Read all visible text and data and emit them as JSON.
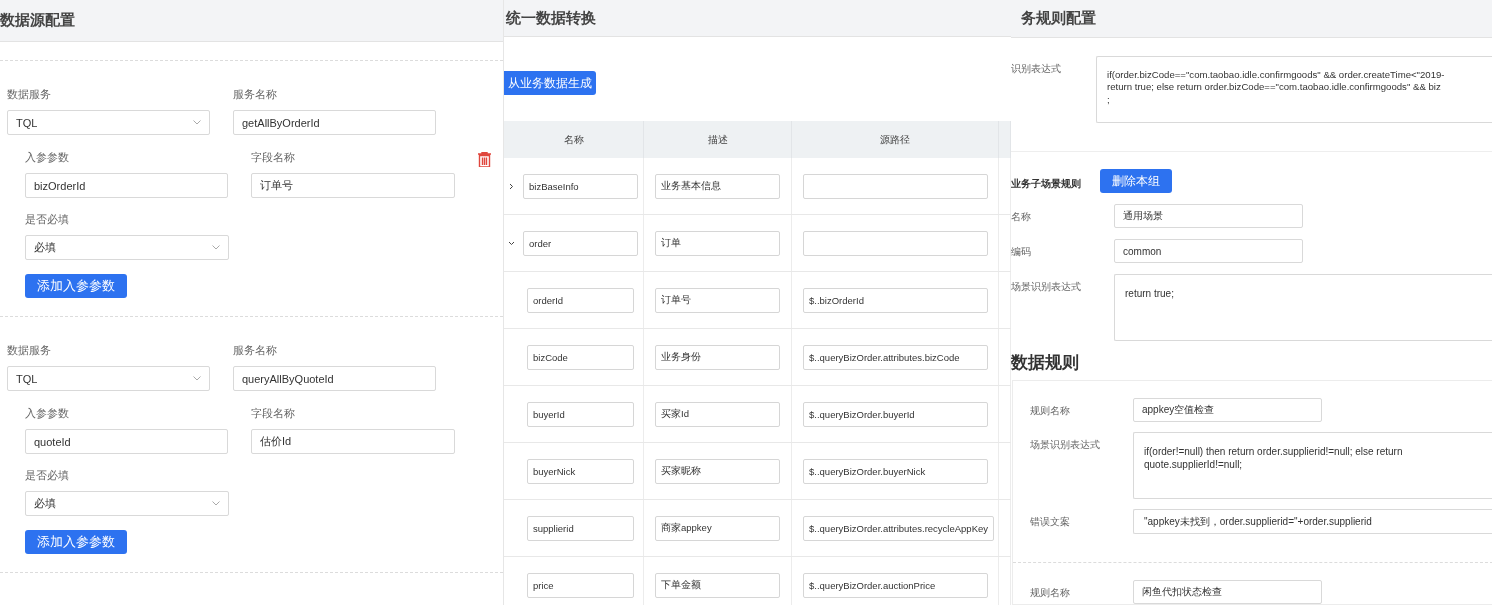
{
  "datasource": {
    "title": "数据源配置",
    "services": [
      {
        "service_label": "数据服务",
        "service_value": "TQL",
        "name_label": "服务名称",
        "name_value": "getAllByOrderId",
        "params": [
          {
            "param_label": "入参参数",
            "param_value": "bizOrderId",
            "field_label": "字段名称",
            "field_value": "订单号",
            "required_label": "是否必填",
            "required_value": "必填",
            "deletable": true
          }
        ],
        "add_button": "添加入参参数"
      },
      {
        "service_label": "数据服务",
        "service_value": "TQL",
        "name_label": "服务名称",
        "name_value": "queryAllByQuoteId",
        "params": [
          {
            "param_label": "入参参数",
            "param_value": "quoteId",
            "field_label": "字段名称",
            "field_value": "估价Id",
            "required_label": "是否必填",
            "required_value": "必填",
            "deletable": false
          }
        ],
        "add_button": "添加入参参数"
      }
    ]
  },
  "transform": {
    "title": "统一数据转换",
    "generate_button": "从业务数据生成",
    "table": {
      "columns": [
        "名称",
        "描述",
        "源路径"
      ],
      "rows": [
        {
          "name": "bizBaseInfo",
          "description": "业务基本信息",
          "expanded": false
        },
        {
          "name": "order",
          "description": "订单",
          "expanded": true,
          "children": [
            {
              "name": "orderId",
              "description": "订单号",
              "path": "$..bizOrderId"
            },
            {
              "name": "bizCode",
              "description": "业务身份",
              "path": "$..queryBizOrder.attributes.bizCode"
            },
            {
              "name": "buyerId",
              "description": "买家Id",
              "path": "$..queryBizOrder.buyerId"
            },
            {
              "name": "buyerNick",
              "description": "买家昵称",
              "path": "$..queryBizOrder.buyerNick"
            },
            {
              "name": "supplierid",
              "description": "商家appkey",
              "path": "$..queryBizOrder.attributes.recycleAppKey"
            },
            {
              "name": "price",
              "description": "下单金额",
              "path": "$..queryBizOrder.auctionPrice"
            }
          ]
        }
      ]
    }
  },
  "rules": {
    "title": "务规则配置",
    "expression_label": "识别表达式",
    "expression_value": "if(order.bizCode==\"com.taobao.idle.confirmgoods\" && order.createTime<\"2019-\nreturn true; else return order.bizCode==\"com.taobao.idle.confirmgoods\" && biz\n;",
    "sub_scene": {
      "label": "业务子场景规则",
      "delete_button": "删除本组",
      "fields": [
        {
          "kind": "input",
          "label": "名称",
          "value": "通用场景"
        },
        {
          "kind": "input",
          "label": "编码",
          "value": "common"
        },
        {
          "kind": "textarea",
          "label": "场景识别表达式",
          "value": "return true;"
        }
      ]
    },
    "data_rules_heading": "数据规则",
    "data_rules": [
      {
        "fields": [
          {
            "kind": "input",
            "label": "规则名称",
            "value": "appkey空值检查"
          },
          {
            "kind": "textarea",
            "label": "场景识别表达式",
            "value": "if(order!=null) then return order.supplierid!=null; else return\nquote.supplierId!=null;"
          },
          {
            "kind": "wide",
            "label": "错误文案",
            "value": "\"appkey未找到，order.supplierid=\"+order.supplierid"
          }
        ]
      },
      {
        "fields": [
          {
            "kind": "input",
            "label": "规则名称",
            "value": "闲鱼代扣状态检查"
          }
        ]
      }
    ]
  }
}
